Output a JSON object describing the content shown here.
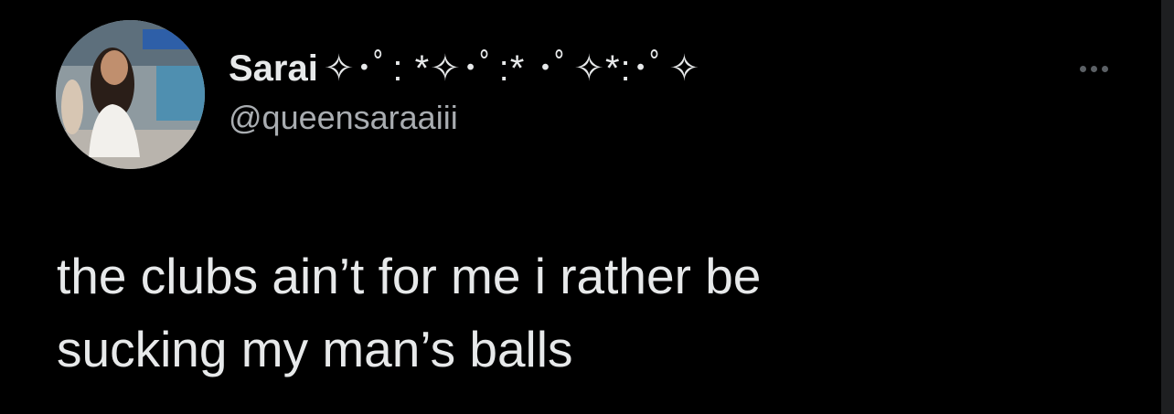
{
  "tweet": {
    "display_name": "Sarai",
    "display_name_decoration": "✧･ﾟ: *✧･ﾟ:* ･ﾟ✧*:･ﾟ✧",
    "handle": "@queensaraaiii",
    "text": "the clubs ain’t for me i rather be\nsucking my man’s balls"
  },
  "colors": {
    "background": "#000000",
    "primary_text": "#e7e9ea",
    "secondary_text": "#a9adb1"
  },
  "icons": {
    "more": "more-horizontal-icon"
  }
}
